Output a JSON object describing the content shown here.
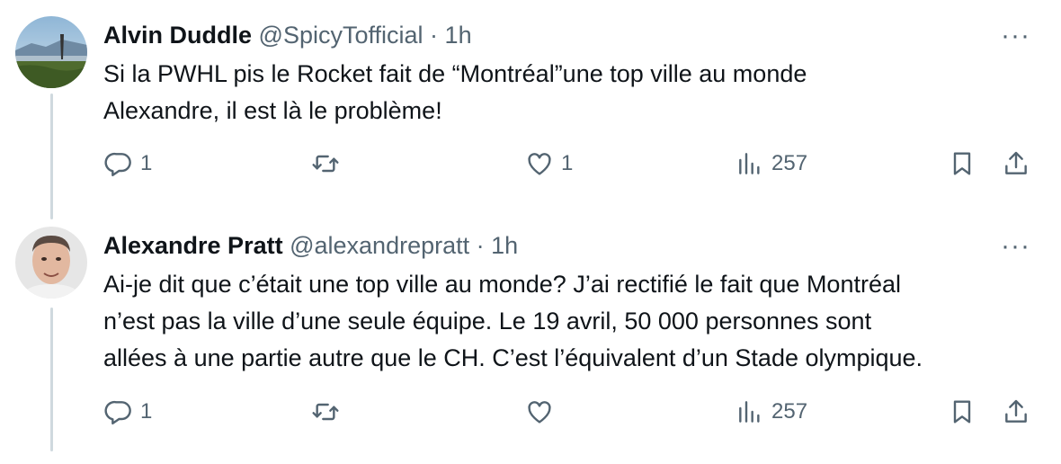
{
  "tweets": [
    {
      "name": "Alvin Duddle",
      "handle": "@SpicyTofficial",
      "separator": "·",
      "time": "1h",
      "more": "···",
      "lines": [
        "Si la PWHL pis le Rocket fait de “Montréal”une top ville au monde",
        "Alexandre, il est là le problème!"
      ],
      "replies": "1",
      "retweets": "",
      "likes": "1",
      "views": "257"
    },
    {
      "name": "Alexandre Pratt",
      "handle": "@alexandrepratt",
      "separator": "·",
      "time": "1h",
      "more": "···",
      "lines": [
        "Ai-je dit que c’était une top ville au monde? J’ai rectifié le fait que Montréal",
        "n’est pas la ville d’une seule équipe. Le 19 avril, 50 000 personnes sont",
        "allées à une partie autre que le CH. C’est l’équivalent d’un Stade olympique."
      ],
      "replies": "1",
      "retweets": "",
      "likes": "",
      "views": "257"
    }
  ],
  "icons": {
    "reply": "reply-icon",
    "retweet": "retweet-icon",
    "like": "heart-icon",
    "views": "views-icon",
    "bookmark": "bookmark-icon",
    "share": "share-icon"
  },
  "colors": {
    "text": "#0f1419",
    "secondary": "#536471",
    "thread_line": "#cfd9de"
  }
}
